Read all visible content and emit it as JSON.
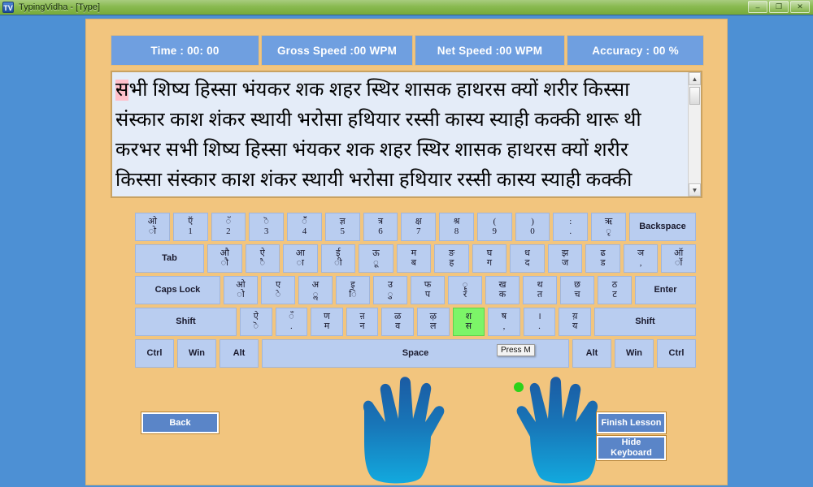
{
  "window": {
    "title": "TypingVidha - [Type]",
    "icon": "app-icon",
    "minimize": "–",
    "maximize": "❐",
    "close": "✕"
  },
  "stats": [
    {
      "label": "Time :   00:  00"
    },
    {
      "label": "Gross Speed :00  WPM"
    },
    {
      "label": "Net Speed :00  WPM"
    },
    {
      "label": "Accuracy :  00    %"
    }
  ],
  "practice_text": {
    "highlight_char": "स",
    "lines": [
      {
        "pre": "",
        "rest": "भी शिष्य हिस्सा भंयकर शक शहर स्थिर शासक हाथरस क्यों शरीर किस्सा"
      },
      {
        "pre": null,
        "rest": "संस्कार काश शंकर स्थायी भरोसा हथियार रस्सी कास्य स्याही कक्की थारू थी"
      },
      {
        "pre": null,
        "rest": "करभर सभी शिष्य हिस्सा भंयकर शक शहर स्थिर शासक हाथरस क्यों शरीर"
      },
      {
        "pre": null,
        "rest": "किस्सा संस्कार काश शंकर स्थायी भरोसा हथियार रस्सी कास्य स्याही कक्की"
      }
    ],
    "scrollbar": {
      "up": "▲",
      "down": "▼"
    }
  },
  "keyboard": {
    "rows": [
      [
        {
          "top": "ओ",
          "bot": "ो",
          "type": "key"
        },
        {
          "top": "ऍ",
          "bot": "1",
          "type": "key"
        },
        {
          "top": "ॅ",
          "bot": "2",
          "type": "key"
        },
        {
          "top": "ॆ",
          "bot": "3",
          "type": "key"
        },
        {
          "top": "ॕ",
          "bot": "4",
          "type": "key"
        },
        {
          "top": "ज्ञ",
          "bot": "5",
          "type": "key"
        },
        {
          "top": "त्र",
          "bot": "6",
          "type": "key"
        },
        {
          "top": "क्ष",
          "bot": "7",
          "type": "key"
        },
        {
          "top": "श्र",
          "bot": "8",
          "type": "key"
        },
        {
          "top": "(",
          "bot": "9",
          "type": "key"
        },
        {
          "top": ")",
          "bot": "0",
          "type": "key"
        },
        {
          "top": ":",
          "bot": ".",
          "type": "key"
        },
        {
          "top": "ऋ",
          "bot": "ृ",
          "type": "key"
        },
        {
          "top": "Backspace",
          "bot": "",
          "type": "word",
          "cls": "k-back"
        }
      ],
      [
        {
          "top": "Tab",
          "bot": "",
          "type": "word",
          "cls": "k-tab"
        },
        {
          "top": "औ",
          "bot": "ौ",
          "type": "key"
        },
        {
          "top": "ऐ",
          "bot": "ै",
          "type": "key"
        },
        {
          "top": "आ",
          "bot": "ा",
          "type": "key"
        },
        {
          "top": "ई",
          "bot": "ी",
          "type": "key"
        },
        {
          "top": "ऊ",
          "bot": "ू",
          "type": "key"
        },
        {
          "top": "म",
          "bot": "ब",
          "type": "key"
        },
        {
          "top": "ङ",
          "bot": "ह",
          "type": "key"
        },
        {
          "top": "घ",
          "bot": "ग",
          "type": "key"
        },
        {
          "top": "ध",
          "bot": "द",
          "type": "key"
        },
        {
          "top": "झ",
          "bot": "ज",
          "type": "key"
        },
        {
          "top": "ढ",
          "bot": "ड",
          "type": "key"
        },
        {
          "top": "ञ",
          "bot": ",",
          "type": "key"
        },
        {
          "top": "ऑ",
          "bot": "ॉ",
          "type": "key"
        }
      ],
      [
        {
          "top": "Caps Lock",
          "bot": "",
          "type": "word",
          "cls": "k-caps"
        },
        {
          "top": "ओ",
          "bot": "ो",
          "type": "key"
        },
        {
          "top": "ए",
          "bot": "े",
          "type": "key"
        },
        {
          "top": "अ",
          "bot": "ॢ",
          "type": "key"
        },
        {
          "top": "इ",
          "bot": "ि",
          "type": "key"
        },
        {
          "top": "उ",
          "bot": "ु",
          "type": "key"
        },
        {
          "top": "फ",
          "bot": "प",
          "type": "key"
        },
        {
          "top": "ॄ",
          "bot": "र",
          "type": "key"
        },
        {
          "top": "ख",
          "bot": "क",
          "type": "key"
        },
        {
          "top": "थ",
          "bot": "त",
          "type": "key"
        },
        {
          "top": "छ",
          "bot": "च",
          "type": "key"
        },
        {
          "top": "ठ",
          "bot": "ट",
          "type": "key"
        },
        {
          "top": "Enter",
          "bot": "",
          "type": "word",
          "cls": "k-enter"
        }
      ],
      [
        {
          "top": "Shift",
          "bot": "",
          "type": "word",
          "cls": "k-shift-l"
        },
        {
          "top": "ऐ",
          "bot": "ॆ",
          "type": "key"
        },
        {
          "top": "ँ",
          "bot": ".",
          "type": "key"
        },
        {
          "top": "ण",
          "bot": "म",
          "type": "key"
        },
        {
          "top": "ऩ",
          "bot": "न",
          "type": "key"
        },
        {
          "top": "ळ",
          "bot": "व",
          "type": "key"
        },
        {
          "top": "ऴ",
          "bot": "ल",
          "type": "key"
        },
        {
          "top": "श",
          "bot": "स",
          "type": "key",
          "active": true
        },
        {
          "top": "ष",
          "bot": ",",
          "type": "key"
        },
        {
          "top": "।",
          "bot": ".",
          "type": "key"
        },
        {
          "top": "य़",
          "bot": "य",
          "type": "key"
        },
        {
          "top": "Shift",
          "bot": "",
          "type": "word",
          "cls": "k-shift-r"
        }
      ],
      [
        {
          "top": "Ctrl",
          "bot": "",
          "type": "word",
          "cls": "k-mod"
        },
        {
          "top": "Win",
          "bot": "",
          "type": "word",
          "cls": "k-mod"
        },
        {
          "top": "Alt",
          "bot": "",
          "type": "word",
          "cls": "k-mod"
        },
        {
          "top": "Space",
          "bot": "",
          "type": "word",
          "cls": "k-space"
        },
        {
          "top": "Alt",
          "bot": "",
          "type": "word",
          "cls": "k-mod"
        },
        {
          "top": "Win",
          "bot": "",
          "type": "word",
          "cls": "k-mod"
        },
        {
          "top": "Ctrl",
          "bot": "",
          "type": "word",
          "cls": "k-mod"
        }
      ]
    ],
    "tooltip": "Press M"
  },
  "buttons": {
    "back": "Back",
    "finish": "Finish Lesson",
    "hide": "Hide\nKeyboard"
  },
  "colors": {
    "panel": "#f2c57e",
    "stat_cell": "#6f9fe0",
    "key": "#b9cdf0",
    "key_active": "#7cf568",
    "highlight": "#ffc0cb",
    "button": "#5a85c8",
    "hand_top": "#1c5a9e",
    "hand_bottom": "#13a8dd",
    "finger_marker": "#2cd21a"
  }
}
